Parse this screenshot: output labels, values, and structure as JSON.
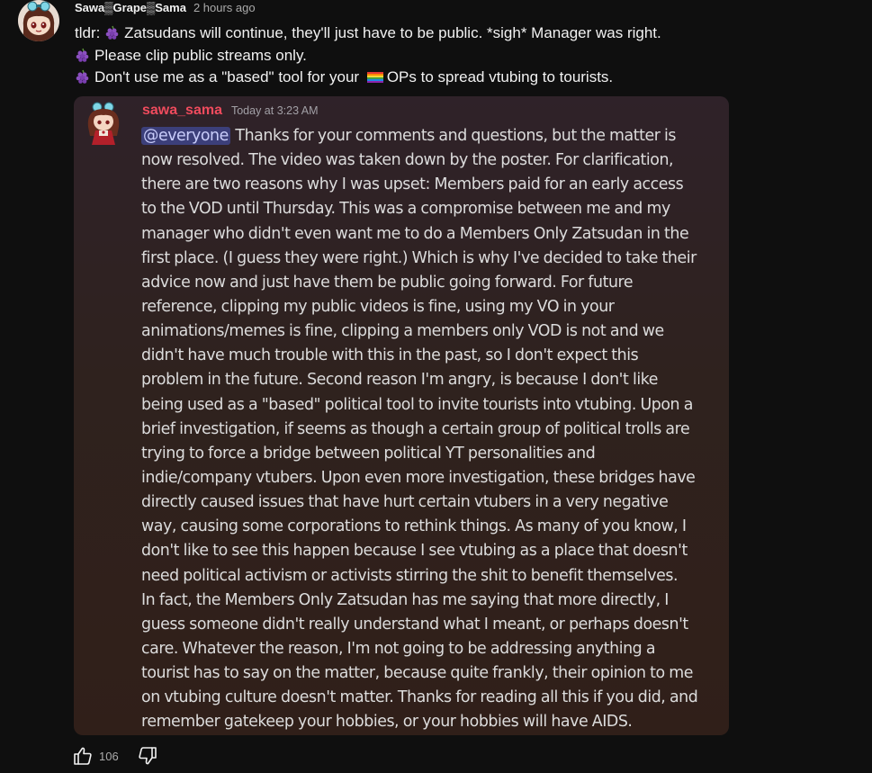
{
  "comment": {
    "author": "Sawa▒Grape▒Sama",
    "timestamp": "2 hours ago",
    "summary_line1": "tldr: ",
    "summary_line1_rest": "Zatsudans will continue, they'll just have to be public. *sigh* Manager was right.",
    "summary_line2": "Please clip public streams only.",
    "summary_line3_a": "Don't use me as a \"based\" tool for your ",
    "summary_line3_b": "OPs to spread vtubing to tourists.",
    "icons": {
      "avatar": "anime-girl-avatar-icon",
      "grape": "grape-emoji-icon",
      "flag": "rainbow-flag-icon"
    }
  },
  "discord": {
    "username": "sawa_sama",
    "timestamp": "Today at 3:23 AM",
    "mention": "@everyone",
    "lines": [
      " Thanks for your comments and questions, but the matter is",
      "now resolved. The video was taken down by the poster. For clarification,",
      "there are two reasons why I was upset: Members paid for an early access",
      "to the VOD until Thursday. This was a compromise between me and my",
      "manager who didn't even want me to do a Members Only Zatsudan in the",
      "first place. (I guess they were right.) Which is why I've decided to take their",
      "advice now and just have them be public going forward. For future",
      "reference, clipping my public videos is fine, using my VO in your",
      "animations/memes is fine, clipping a members only VOD is not and we",
      "didn't have much trouble with this in the past, so I don't expect this",
      "problem in the future. Second reason I'm angry, is because I don't like",
      "being used as a \"based\" political tool to invite tourists into vtubing. Upon a",
      "brief investigation, if seems as though a certain group of political trolls are",
      "trying to force a bridge between political YT personalities and",
      "indie/company vtubers. Upon even more investigation, these bridges have",
      "directly caused issues that have hurt certain vtubers in a very negative",
      "way, causing some corporations to rethink things. As many of you know, I",
      "don't like to see this happen because I see vtubing as a place that doesn't",
      "need political activism or activists stirring the shit to benefit themselves.",
      "In fact, the Members Only Zatsudan has me saying that more directly, I",
      "guess someone didn't really understand what I meant, or perhaps doesn't",
      "care. Whatever the reason, I'm not going to be addressing anything a",
      "tourist has to say on the matter, because quite frankly, their opinion to me",
      "on vtubing culture doesn't matter. Thanks for reading all this if you did, and",
      "remember gatekeep your hobbies, or your hobbies will have AIDS."
    ]
  },
  "actions": {
    "like_count": "106",
    "like_icon": "thumbs-up-icon",
    "dislike_icon": "thumbs-down-icon"
  },
  "colors": {
    "background": "#0f0f0f",
    "discord_username": "#ef4b5d",
    "mention_bg": "#3c3f7a",
    "mention_text": "#c9cdfb"
  }
}
